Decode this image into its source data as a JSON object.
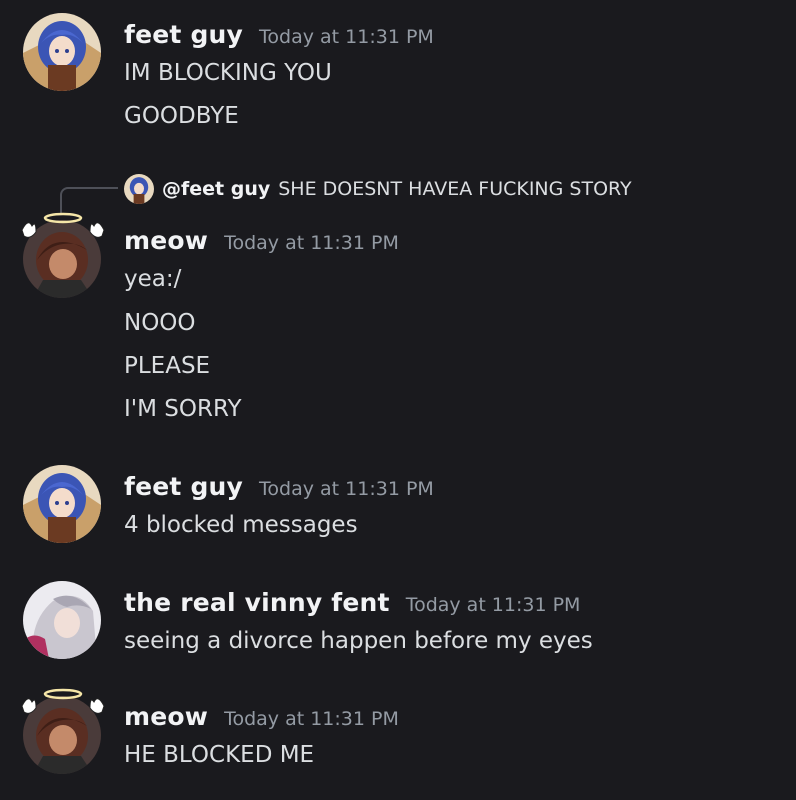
{
  "messages": [
    {
      "author": "feet guy",
      "time": "Today at 11:31 PM",
      "lines": [
        "IM BLOCKING YOU",
        "GOODBYE"
      ]
    },
    {
      "reply": {
        "mention": "@feet guy",
        "text": "SHE DOESNT HAVEA FUCKING STORY"
      },
      "author": "meow",
      "time": "Today at 11:31 PM",
      "lines": [
        "yea:/",
        "NOOO",
        "PLEASE",
        "I'M SORRY"
      ]
    },
    {
      "author": "feet guy",
      "time": "Today at 11:31 PM",
      "lines": [
        "4 blocked messages"
      ]
    },
    {
      "author": "the real vinny fent",
      "time": "Today at 11:31 PM",
      "lines": [
        "seeing a divorce happen before my eyes"
      ]
    },
    {
      "author": "meow",
      "time": "Today at 11:31 PM",
      "lines": [
        "HE BLOCKED ME"
      ]
    }
  ],
  "colors": {
    "background": "#1a1a1e",
    "username": "#f2f3f5",
    "timestamp": "#949ba4",
    "text": "#dbdee1",
    "halo": "#f5e6a8"
  },
  "icons": {
    "feet_guy_avatar": "anime-girl-blue-hair-avatar",
    "meow_avatar": "anime-boy-brown-hair-avatar",
    "meow_decoration": "halo-and-wings-decoration",
    "vinny_avatar": "anime-silver-hair-avatar"
  }
}
